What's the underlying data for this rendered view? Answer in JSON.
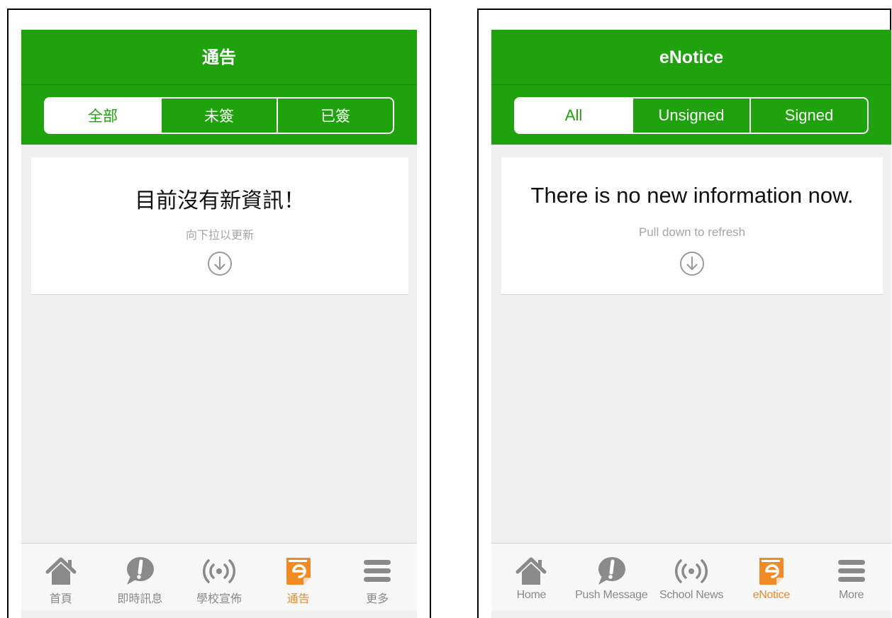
{
  "colors": {
    "brand_green": "#1fa20e",
    "active_orange": "#f08a24",
    "inactive_gray": "#8a8a8a"
  },
  "screens": [
    {
      "nav_title": "通告",
      "segments": [
        "全部",
        "未簽",
        "已簽"
      ],
      "active_segment": "全部",
      "empty_message": "目前沒有新資訊！",
      "refresh_hint": "向下拉以更新",
      "tabs": [
        {
          "label": "首頁",
          "icon": "home-icon"
        },
        {
          "label": "即時訊息",
          "icon": "exclamation-bubble-icon"
        },
        {
          "label": "學校宣佈",
          "icon": "broadcast-icon"
        },
        {
          "label": "通告",
          "icon": "enotice-icon",
          "active": true
        },
        {
          "label": "更多",
          "icon": "menu-icon"
        }
      ]
    },
    {
      "nav_title": "eNotice",
      "segments": [
        "All",
        "Unsigned",
        "Signed"
      ],
      "active_segment": "All",
      "empty_message": "There is no new information now.",
      "refresh_hint": "Pull down to refresh",
      "tabs": [
        {
          "label": "Home",
          "icon": "home-icon"
        },
        {
          "label": "Push Message",
          "icon": "exclamation-bubble-icon"
        },
        {
          "label": "School News",
          "icon": "broadcast-icon"
        },
        {
          "label": "eNotice",
          "icon": "enotice-icon",
          "active": true
        },
        {
          "label": "More",
          "icon": "menu-icon"
        }
      ]
    }
  ]
}
